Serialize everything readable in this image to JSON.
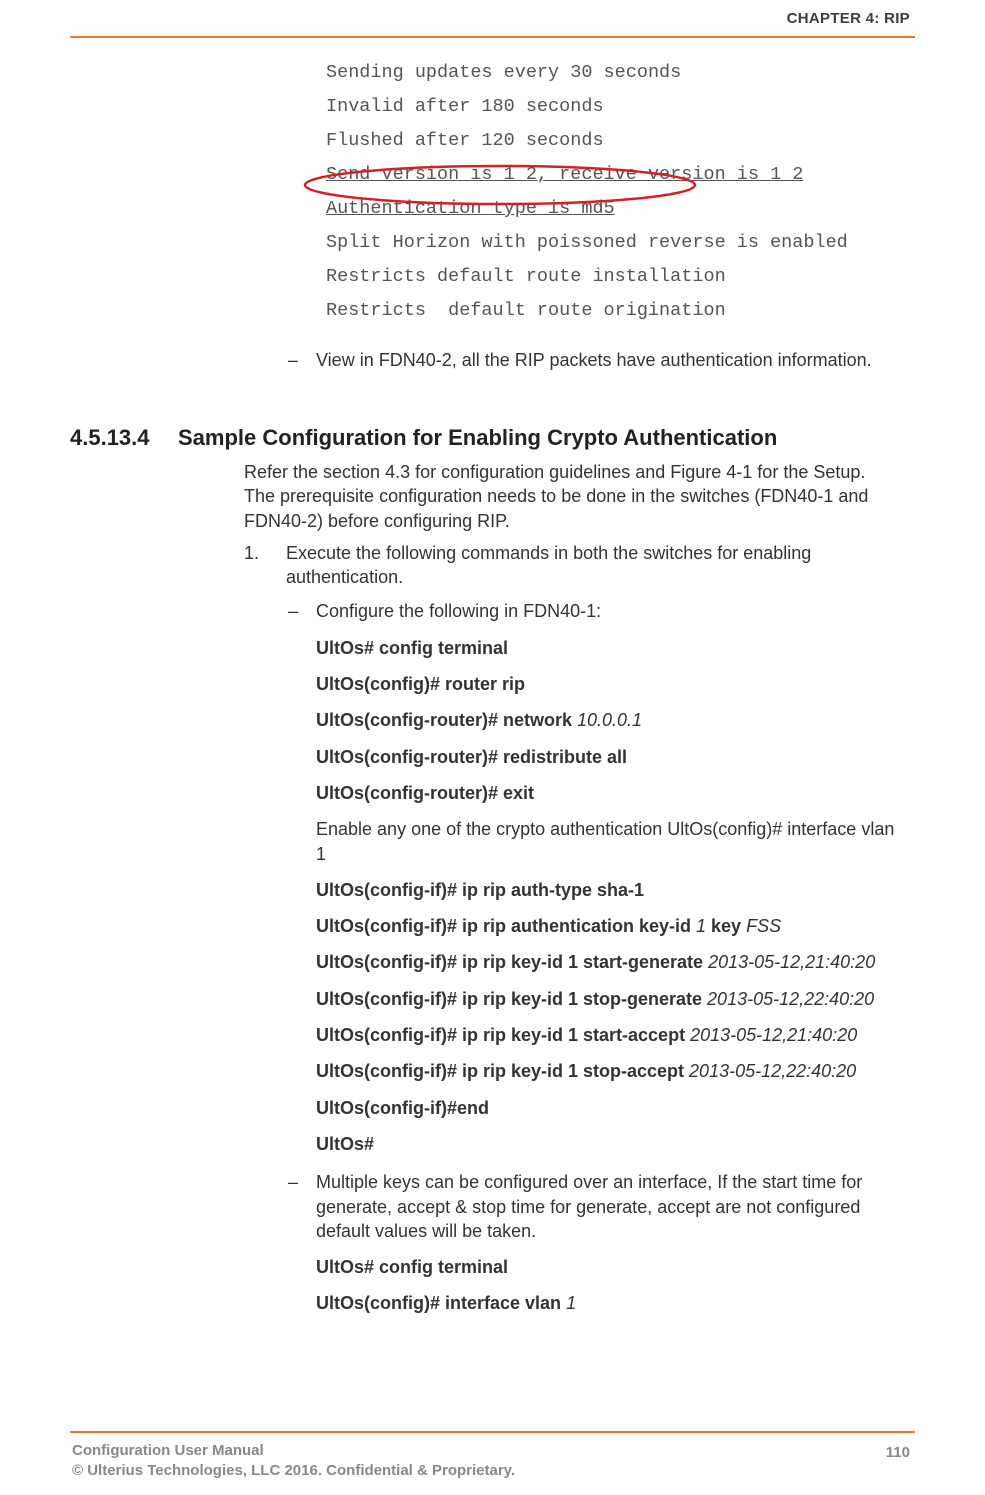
{
  "header": {
    "chapter": "CHAPTER 4: RIP"
  },
  "mono": {
    "lines": [
      "Sending updates every 30 seconds",
      "Invalid after 180 seconds",
      "Flushed after 120 seconds",
      "Send version is 1 2, receive version is 1 2",
      "Authentication type is md5",
      "Split Horizon with poissoned reverse is enabled",
      "Restricts default route installation",
      "Restricts  default route origination"
    ]
  },
  "preDash": "View in FDN40-2, all the RIP packets have authentication information.",
  "heading": {
    "num": "4.5.13.4",
    "text": "Sample Configuration for Enabling Crypto Authentication"
  },
  "intro": "Refer the section 4.3 for configuration guidelines and Figure 4-1 for the Setup. The prerequisite configuration needs to be done in the switches (FDN40-1 and FDN40-2) before configuring RIP.",
  "step1": {
    "num": "1.",
    "text": "Execute the following commands in both the switches for enabling authentication."
  },
  "subA": "Configure the following in FDN40-1:",
  "cmds": {
    "c1": {
      "b": "UltOs# config terminal"
    },
    "c2": {
      "b": "UltOs(config)# router rip"
    },
    "c3": {
      "b": "UltOs(config-router)# network ",
      "i": "10.0.0.1"
    },
    "c4": {
      "b": "UltOs(config-router)# redistribute all"
    },
    "c5": {
      "b": "UltOs(config-router)# exit"
    },
    "enable_note_pre": "Enable any one of the crypto authentication ",
    "enable_note_b": "UltOs(config)# interface vlan ",
    "enable_note_i": "1",
    "c6": {
      "b": "UltOs(config-if)# ip rip auth-type sha-1"
    },
    "c7": {
      "b": "UltOs(config-if)# ip rip authentication key-id ",
      "i1": "1 ",
      "b2": "key ",
      "i2": "FSS"
    },
    "c8": {
      "b": "UltOs(config-if)# ip rip key-id 1 start-generate ",
      "i": "2013-05-12,21:40:20"
    },
    "c9": {
      "b": "UltOs(config-if)# ip rip key-id 1 stop-generate ",
      "i": "2013-05-12,22:40:20"
    },
    "c10": {
      "b": "UltOs(config-if)# ip rip key-id 1 start-accept ",
      "i": "2013-05-12,21:40:20"
    },
    "c11": {
      "b": "UltOs(config-if)# ip rip key-id 1 stop-accept ",
      "i": "2013-05-12,22:40:20"
    },
    "c12": {
      "b": "UltOs(config-if)#end"
    },
    "c13": {
      "b": "UltOs#"
    }
  },
  "subB": "Multiple keys can be configured over an interface, If the start time for generate, accept & stop time for generate, accept are not configured default values will be taken.",
  "cmds2": {
    "c1": {
      "b": "UltOs# config terminal"
    },
    "c2": {
      "b": "UltOs(config)# interface vlan ",
      "i": "1"
    }
  },
  "footer": {
    "left1": "Configuration User Manual",
    "left2": "© Ulterius Technologies, LLC 2016. Confidential & Proprietary.",
    "page": "110"
  }
}
